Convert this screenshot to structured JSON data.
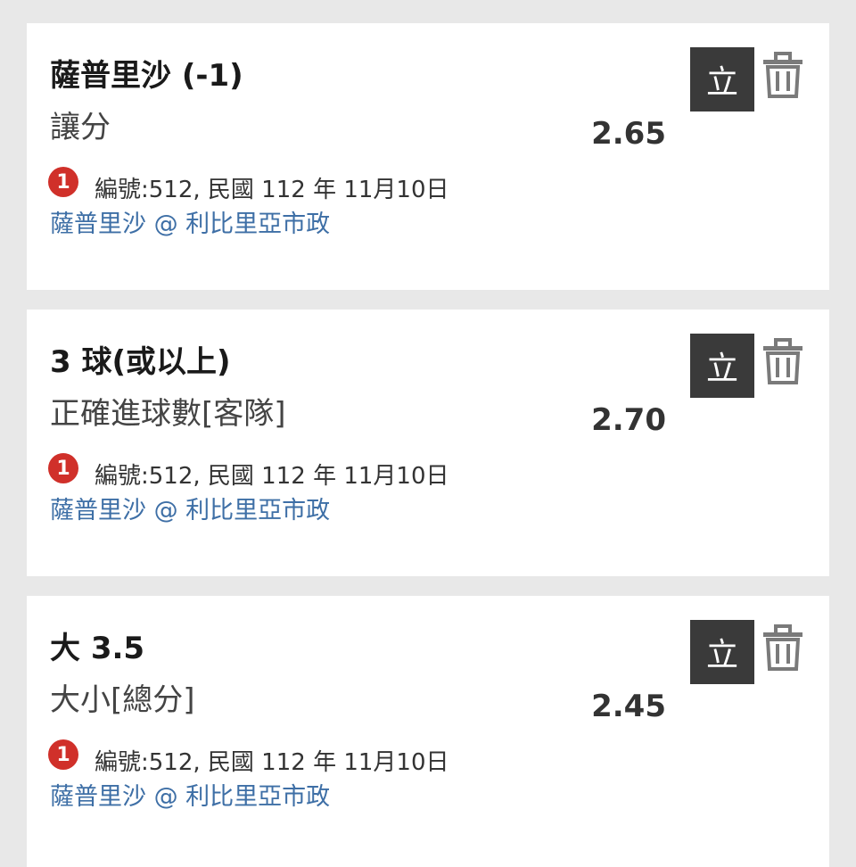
{
  "bets": [
    {
      "selection": "薩普里沙 (-1)",
      "market": "讓分",
      "odds": "2.65",
      "badge": "1",
      "info": "編號:512, 民國 112 年 11月10日",
      "match": "薩普里沙 @ 利比里亞市政",
      "instant_label": "立"
    },
    {
      "selection": "3 球(或以上)",
      "market": "正確進球數[客隊]",
      "odds": "2.70",
      "badge": "1",
      "info": "編號:512, 民國 112 年 11月10日",
      "match": "薩普里沙 @ 利比里亞市政",
      "instant_label": "立"
    },
    {
      "selection": "大 3.5",
      "market": "大小[總分]",
      "odds": "2.45",
      "badge": "1",
      "info": "編號:512, 民國 112 年 11月10日",
      "match": "薩普里沙 @ 利比里亞市政",
      "instant_label": "立"
    }
  ],
  "icons": {
    "delete": "trash-icon"
  },
  "colors": {
    "background": "#e8e8e8",
    "card": "#ffffff",
    "badge": "#d0302a",
    "match_link": "#3e6fa6",
    "instant_button": "#3a3a3a",
    "trash": "#7a7a7a"
  }
}
